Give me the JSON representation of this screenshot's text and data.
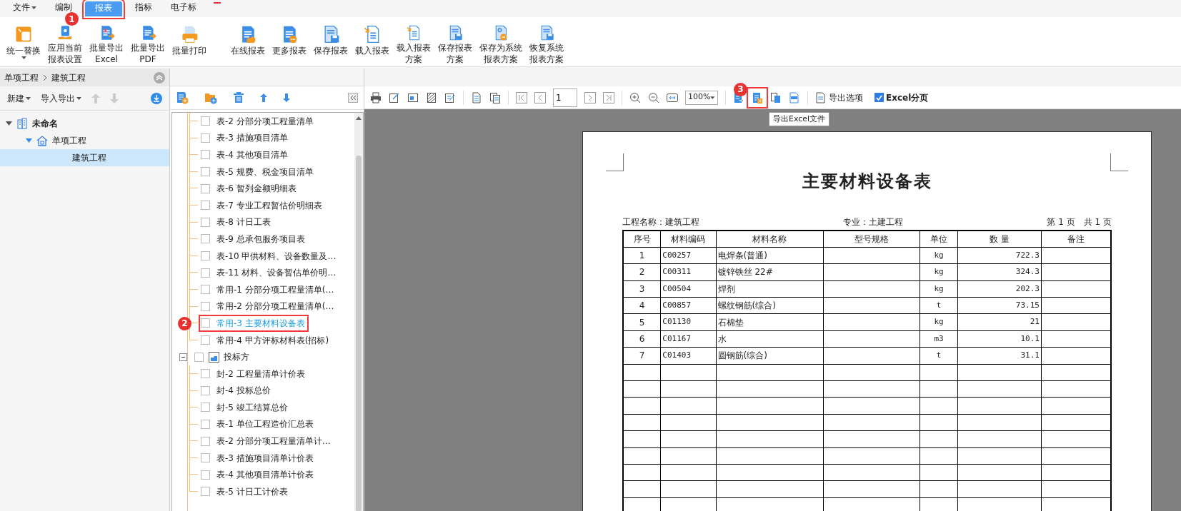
{
  "menu_tabs": [
    {
      "label": "文件",
      "dropdown": true,
      "selected": false
    },
    {
      "label": "编制",
      "dropdown": false,
      "selected": false
    },
    {
      "label": "报表",
      "dropdown": false,
      "selected": true,
      "callout": "1"
    },
    {
      "label": "指标",
      "dropdown": false,
      "selected": false
    },
    {
      "label": "电子标",
      "dropdown": false,
      "selected": false
    }
  ],
  "ribbon": [
    {
      "kind": "replace",
      "lines": [
        "统一替换"
      ],
      "dropdown": true
    },
    {
      "kind": "settings",
      "lines": [
        "应用当前",
        "报表设置"
      ],
      "dropdown": false
    },
    {
      "kind": "excel",
      "lines": [
        "批量导出",
        "Excel"
      ],
      "dropdown": false
    },
    {
      "kind": "pdf",
      "lines": [
        "批量导出",
        "PDF"
      ],
      "dropdown": false
    },
    {
      "kind": "print",
      "lines": [
        "批量打印"
      ],
      "dropdown": false
    },
    {
      "kind": "online",
      "lines": [
        "在线报表"
      ],
      "dropdown": false
    },
    {
      "kind": "more",
      "lines": [
        "更多报表"
      ],
      "dropdown": false
    },
    {
      "kind": "save",
      "lines": [
        "保存报表"
      ],
      "dropdown": false
    },
    {
      "kind": "load",
      "lines": [
        "载入报表"
      ],
      "dropdown": false
    },
    {
      "kind": "load",
      "lines": [
        "载入报表",
        "方案"
      ],
      "dropdown": false
    },
    {
      "kind": "save",
      "lines": [
        "保存报表",
        "方案"
      ],
      "dropdown": false
    },
    {
      "kind": "restore",
      "lines": [
        "保存为系统",
        "报表方案"
      ],
      "dropdown": false
    },
    {
      "kind": "save",
      "lines": [
        "恢复系统",
        "报表方案"
      ],
      "dropdown": false
    }
  ],
  "breadcrumb": [
    "单项工程",
    "建筑工程"
  ],
  "left_toolbar": [
    {
      "label": "新建",
      "dropdown": true
    },
    {
      "label": "导入导出",
      "dropdown": true
    }
  ],
  "project_tree": [
    {
      "label": "未命名",
      "kind": "building",
      "expanded": true,
      "selected": false,
      "children": [
        {
          "label": "单项工程",
          "kind": "house",
          "expanded": true,
          "selected": false,
          "children": [
            {
              "label": "建筑工程",
              "selected": true
            }
          ]
        }
      ]
    }
  ],
  "report_tree": [
    {
      "children": [
        {
          "label": "表-2 分部分项工程量清单",
          "checked": false,
          "selected": false
        },
        {
          "label": "表-3 措施项目清单",
          "checked": false,
          "selected": false
        },
        {
          "label": "表-4 其他项目清单",
          "checked": false,
          "selected": false
        },
        {
          "label": "表-5 规费、税金项目清单",
          "checked": false,
          "selected": false
        },
        {
          "label": "表-6 暂列金额明细表",
          "checked": false,
          "selected": false
        },
        {
          "label": "表-7 专业工程暂估价明细表",
          "checked": false,
          "selected": false
        },
        {
          "label": "表-8 计日工表",
          "checked": false,
          "selected": false
        },
        {
          "label": "表-9 总承包服务项目表",
          "checked": false,
          "selected": false
        },
        {
          "label": "表-10 甲供材料、设备数量及…",
          "checked": false,
          "selected": false
        },
        {
          "label": "表-11 材料、设备暂估单价明…",
          "checked": false,
          "selected": false
        },
        {
          "label": "常用-1 分部分项工程量清单(…",
          "checked": false,
          "selected": false
        },
        {
          "label": "常用-2 分部分项工程量清单(…",
          "checked": false,
          "selected": false
        },
        {
          "label": "常用-3 主要材料设备表",
          "checked": false,
          "selected": true,
          "callout": "2"
        },
        {
          "label": "常用-4 甲方评标材料表(招标)",
          "checked": false,
          "selected": false
        }
      ]
    },
    {
      "label": "投标方",
      "expanded": true,
      "checked": false,
      "children": [
        {
          "label": "封-2 工程量清单计价表",
          "checked": false,
          "selected": false
        },
        {
          "label": "封-4 投标总价",
          "checked": false,
          "selected": false
        },
        {
          "label": "封-5 竣工结算总价",
          "checked": false,
          "selected": false
        },
        {
          "label": "表-1 单位工程造价汇总表",
          "checked": false,
          "selected": false
        },
        {
          "label": "表-2 分部分项工程量清单计…",
          "checked": false,
          "selected": false
        },
        {
          "label": "表-3 措施项目清单计价表",
          "checked": false,
          "selected": false
        },
        {
          "label": "表-4 其他项目清单计价表",
          "checked": false,
          "selected": false
        },
        {
          "label": "表-5 计日工计价表",
          "checked": false,
          "selected": false
        }
      ]
    }
  ],
  "viewer_toolbar": {
    "page": "1",
    "zoom": "100%",
    "export_options": "导出选项",
    "excel_paging": {
      "label": "Excel分页",
      "checked": true
    },
    "export_excel": {
      "callout": "3",
      "tooltip": "导出Excel文件"
    }
  },
  "report": {
    "title": "主要材料设备表",
    "project": "工程名称：建筑工程",
    "specialty": "专业：土建工程",
    "page_info": "第 1 页　共 1 页",
    "columns": [
      "序号",
      "材料编码",
      "材料名称",
      "型号规格",
      "单位",
      "数 量",
      "备注"
    ],
    "rows": [
      [
        "1",
        "C00257",
        "电焊条(普通)",
        "",
        "kg",
        "722.3",
        ""
      ],
      [
        "2",
        "C00311",
        "镀锌铁丝 22#",
        "",
        "kg",
        "324.3",
        ""
      ],
      [
        "3",
        "C00504",
        "焊剂",
        "",
        "kg",
        "202.3",
        ""
      ],
      [
        "4",
        "C00857",
        "螺纹钢筋(综合)",
        "",
        "t",
        "73.15",
        ""
      ],
      [
        "5",
        "C01130",
        "石棉垫",
        "",
        "kg",
        "21",
        ""
      ],
      [
        "6",
        "C01167",
        "水",
        "",
        "m3",
        "10.1",
        ""
      ],
      [
        "7",
        "C01403",
        "圆钢筋(综合)",
        "",
        "t",
        "31.1",
        ""
      ]
    ]
  }
}
